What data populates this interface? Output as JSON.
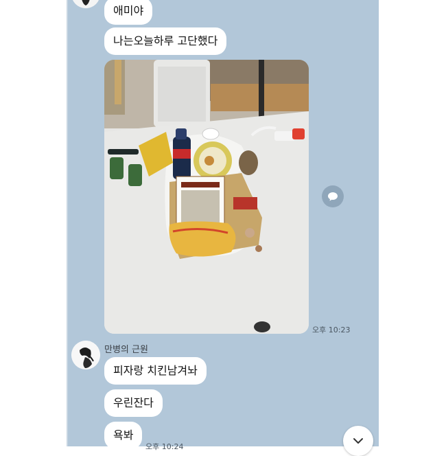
{
  "messages_top": [
    {
      "text": "애미야"
    },
    {
      "text": "나는오늘하루 고단했다"
    }
  ],
  "photo_message": {
    "time": "오후 10:23",
    "description_icon": "photo-image"
  },
  "second_sender": {
    "name": "만병의 근원",
    "messages": [
      {
        "text": "피자랑 치킨남겨놔"
      },
      {
        "text": "우린잔다"
      },
      {
        "text": "욕봐"
      }
    ],
    "time": "오후 10:24"
  },
  "icons": {
    "share": "share-icon",
    "scroll_down": "chevron-down-icon"
  },
  "colors": {
    "chat_background": "#b2c7d9",
    "bubble": "#ffffff",
    "share_button": "#8fa6ba"
  }
}
